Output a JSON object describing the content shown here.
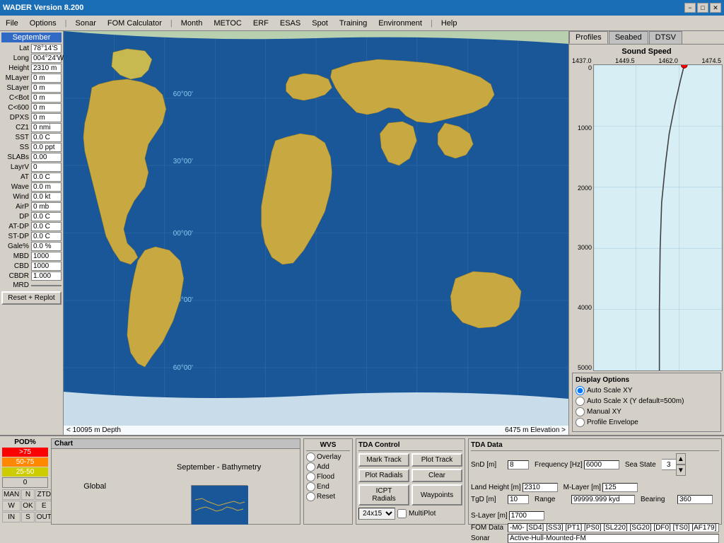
{
  "titleBar": {
    "title": "WADER Version 8.200",
    "minimize": "−",
    "maximize": "□",
    "close": "✕"
  },
  "menuBar": {
    "items": [
      "File",
      "Options",
      "|",
      "Sonar",
      "FOM Calculator",
      "|",
      "Month",
      "METOC",
      "ERF",
      "ESAS",
      "Spot",
      "Training",
      "Environment",
      "|",
      "Help"
    ]
  },
  "leftPanel": {
    "header": "September",
    "fields": [
      {
        "label": "Lat",
        "value": "78°14'S"
      },
      {
        "label": "Long",
        "value": "004°24'W"
      },
      {
        "label": "Height",
        "value": "2310 m"
      },
      {
        "label": "MLayer",
        "value": "0 m"
      },
      {
        "label": "SLayer",
        "value": "0 m"
      },
      {
        "label": "C<Bot",
        "value": "0 m"
      },
      {
        "label": "C<600",
        "value": "0 m"
      },
      {
        "label": "DPXS",
        "value": "0 m"
      },
      {
        "label": "CZ1",
        "value": "0 nmi"
      },
      {
        "label": "SST",
        "value": "0.0 C"
      },
      {
        "label": "SS",
        "value": "0.0 ppt"
      },
      {
        "label": "SLABs",
        "value": "0.00"
      },
      {
        "label": "LayrV",
        "value": "0"
      },
      {
        "label": "AT",
        "value": "0.0 C"
      },
      {
        "label": "Wave",
        "value": "0.0 m"
      },
      {
        "label": "Wind",
        "value": "0.0 kt"
      },
      {
        "label": "AirP",
        "value": "0 mb"
      },
      {
        "label": "DP",
        "value": "0.0 C"
      },
      {
        "label": "AT-DP",
        "value": "0.0 C"
      },
      {
        "label": "ST-DP",
        "value": "0.0 C"
      },
      {
        "label": "Gale%",
        "value": "0.0 %"
      },
      {
        "label": "MBD",
        "value": "1000"
      },
      {
        "label": "CBD",
        "value": "1000"
      },
      {
        "label": "CBDR",
        "value": "1.000"
      },
      {
        "label": "MRD",
        "value": ""
      }
    ],
    "resetBtn": "Reset + Replot"
  },
  "mapArea": {
    "statusBottom": {
      "left": "< 10095 m Depth",
      "right": "6475 m Elevation >"
    }
  },
  "rightPanel": {
    "tabs": [
      "Profiles",
      "Seabed",
      "DTSV"
    ],
    "activeTab": "Profiles",
    "soundSpeedTitle": "Sound Speed",
    "xLabels": [
      "1437.0",
      "1449.5",
      "1462.0",
      "1474.5"
    ],
    "yLabels": [
      "0",
      "1000",
      "2000",
      "3000",
      "4000",
      "5000"
    ],
    "displayOptions": {
      "title": "Display Options",
      "options": [
        "Auto Scale XY",
        "Auto Scale X (Y default=500m)",
        "Manual XY",
        "Profile Envelope"
      ],
      "selected": 0
    }
  },
  "bottomPanel": {
    "pod": {
      "label": "POD%",
      "levels": [
        ">75",
        "50-75",
        "25-50",
        "0"
      ],
      "grid": [
        "MAN",
        "N",
        "ZTD",
        "W",
        "OK",
        "E",
        "IN",
        "S",
        "OUT"
      ]
    },
    "chart": {
      "header": "Chart",
      "global": "Global",
      "title": "September - Bathymetry"
    },
    "wvs": {
      "title": "WVS",
      "options": [
        "Overlay",
        "Add",
        "Flood",
        "End",
        "Reset"
      ]
    },
    "tdaControl": {
      "title": "TDA Control",
      "buttons": [
        "Mark Track",
        "Plot Track",
        "Plot Radials",
        "Clear",
        "ICPT Radials",
        "Waypoints"
      ],
      "selectValue": "24x15",
      "multiplot": "MultiPlot"
    },
    "tdaData": {
      "title": "TDA Data",
      "snD": {
        "label": "SnD [m]",
        "value": "8"
      },
      "frequency": {
        "label": "Frequency [Hz]",
        "value": "6000"
      },
      "seaState": {
        "label": "Sea State",
        "value": "3"
      },
      "tgD": {
        "label": "TgD [m]",
        "value": "10"
      },
      "range": {
        "label": "Range",
        "value": "99999.999 kyd"
      },
      "bearing": {
        "label": "Bearing",
        "value": "360"
      },
      "landHeight": {
        "label": "Land Height [m]",
        "value": "2310"
      },
      "mLayer": {
        "label": "M-Layer [m]",
        "value": "125"
      },
      "sLayer": {
        "label": "S-Layer [m]",
        "value": "1700"
      },
      "fomData": {
        "label": "FOM Data",
        "value": "-M0- [SD4] [SS3] [PT1] [PS0] [SL220] [SG20] [DF0] [TS0] [AF179]"
      },
      "sonar": {
        "label": "Sonar",
        "value": "Active-Hull-Mounted-FM"
      }
    }
  }
}
